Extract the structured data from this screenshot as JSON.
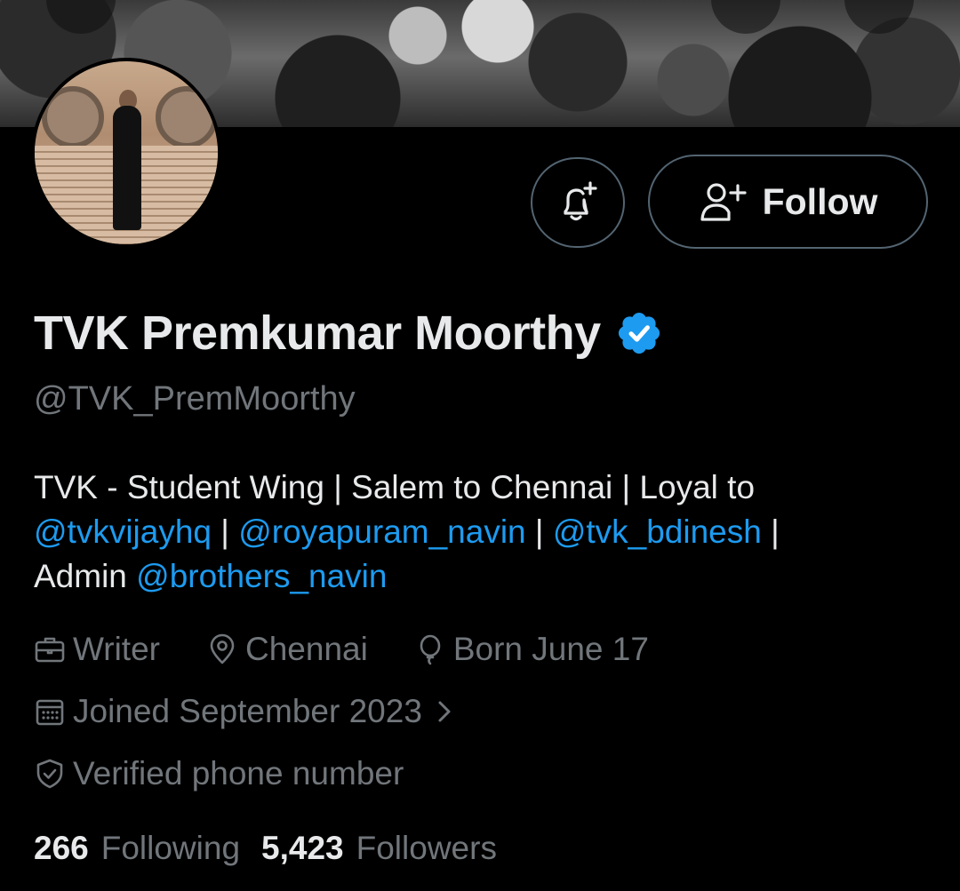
{
  "profile": {
    "display_name": "TVK Premkumar Moorthy",
    "handle": "@TVK_PremMoorthy",
    "verified": true,
    "bio": {
      "line1": "TVK - Student Wing | Salem to Chennai | Loyal to",
      "mention1": "@tvkvijayhq",
      "sep1": " | ",
      "mention2": "@royapuram_navin",
      "sep2": " | ",
      "mention3": "@tvk_bdinesh",
      "sep3": " |",
      "admin_prefix": "Admin ",
      "mention4": "@brothers_navin"
    },
    "profession": "Writer",
    "location": "Chennai",
    "birthday": "Born June 17",
    "joined": "Joined September 2023",
    "verified_phone": "Verified phone number",
    "following_count": "266",
    "following_label": "Following",
    "followers_count": "5,423",
    "followers_label": "Followers"
  },
  "actions": {
    "follow_label": "Follow"
  },
  "icons": {
    "notify": "bell-plus-icon",
    "follow": "person-plus-icon",
    "verified": "verified-badge-icon",
    "profession": "briefcase-icon",
    "location": "location-pin-icon",
    "birthday": "balloon-icon",
    "joined": "calendar-icon",
    "chevron": "chevron-right-icon",
    "phone": "shield-check-icon"
  },
  "colors": {
    "background": "#000000",
    "text_primary": "#e7e9ea",
    "text_secondary": "#71767b",
    "link": "#1d9bf0",
    "button_border": "#536471"
  }
}
